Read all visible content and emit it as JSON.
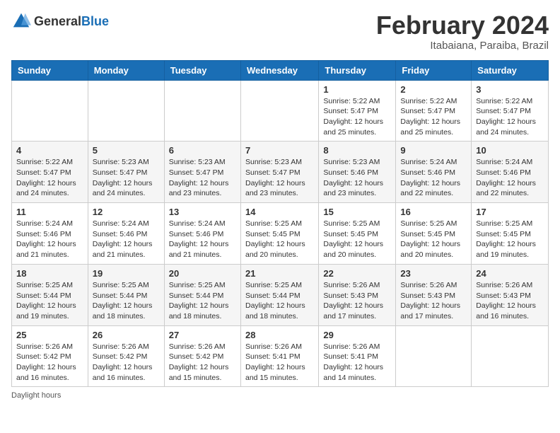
{
  "header": {
    "logo": {
      "general": "General",
      "blue": "Blue"
    },
    "title": "February 2024",
    "location": "Itabaiana, Paraiba, Brazil"
  },
  "calendar": {
    "days_of_week": [
      "Sunday",
      "Monday",
      "Tuesday",
      "Wednesday",
      "Thursday",
      "Friday",
      "Saturday"
    ],
    "weeks": [
      [
        {
          "day": "",
          "info": ""
        },
        {
          "day": "",
          "info": ""
        },
        {
          "day": "",
          "info": ""
        },
        {
          "day": "",
          "info": ""
        },
        {
          "day": "1",
          "info": "Sunrise: 5:22 AM\nSunset: 5:47 PM\nDaylight: 12 hours and 25 minutes."
        },
        {
          "day": "2",
          "info": "Sunrise: 5:22 AM\nSunset: 5:47 PM\nDaylight: 12 hours and 25 minutes."
        },
        {
          "day": "3",
          "info": "Sunrise: 5:22 AM\nSunset: 5:47 PM\nDaylight: 12 hours and 24 minutes."
        }
      ],
      [
        {
          "day": "4",
          "info": "Sunrise: 5:22 AM\nSunset: 5:47 PM\nDaylight: 12 hours and 24 minutes."
        },
        {
          "day": "5",
          "info": "Sunrise: 5:23 AM\nSunset: 5:47 PM\nDaylight: 12 hours and 24 minutes."
        },
        {
          "day": "6",
          "info": "Sunrise: 5:23 AM\nSunset: 5:47 PM\nDaylight: 12 hours and 23 minutes."
        },
        {
          "day": "7",
          "info": "Sunrise: 5:23 AM\nSunset: 5:47 PM\nDaylight: 12 hours and 23 minutes."
        },
        {
          "day": "8",
          "info": "Sunrise: 5:23 AM\nSunset: 5:46 PM\nDaylight: 12 hours and 23 minutes."
        },
        {
          "day": "9",
          "info": "Sunrise: 5:24 AM\nSunset: 5:46 PM\nDaylight: 12 hours and 22 minutes."
        },
        {
          "day": "10",
          "info": "Sunrise: 5:24 AM\nSunset: 5:46 PM\nDaylight: 12 hours and 22 minutes."
        }
      ],
      [
        {
          "day": "11",
          "info": "Sunrise: 5:24 AM\nSunset: 5:46 PM\nDaylight: 12 hours and 21 minutes."
        },
        {
          "day": "12",
          "info": "Sunrise: 5:24 AM\nSunset: 5:46 PM\nDaylight: 12 hours and 21 minutes."
        },
        {
          "day": "13",
          "info": "Sunrise: 5:24 AM\nSunset: 5:46 PM\nDaylight: 12 hours and 21 minutes."
        },
        {
          "day": "14",
          "info": "Sunrise: 5:25 AM\nSunset: 5:45 PM\nDaylight: 12 hours and 20 minutes."
        },
        {
          "day": "15",
          "info": "Sunrise: 5:25 AM\nSunset: 5:45 PM\nDaylight: 12 hours and 20 minutes."
        },
        {
          "day": "16",
          "info": "Sunrise: 5:25 AM\nSunset: 5:45 PM\nDaylight: 12 hours and 20 minutes."
        },
        {
          "day": "17",
          "info": "Sunrise: 5:25 AM\nSunset: 5:45 PM\nDaylight: 12 hours and 19 minutes."
        }
      ],
      [
        {
          "day": "18",
          "info": "Sunrise: 5:25 AM\nSunset: 5:44 PM\nDaylight: 12 hours and 19 minutes."
        },
        {
          "day": "19",
          "info": "Sunrise: 5:25 AM\nSunset: 5:44 PM\nDaylight: 12 hours and 18 minutes."
        },
        {
          "day": "20",
          "info": "Sunrise: 5:25 AM\nSunset: 5:44 PM\nDaylight: 12 hours and 18 minutes."
        },
        {
          "day": "21",
          "info": "Sunrise: 5:25 AM\nSunset: 5:44 PM\nDaylight: 12 hours and 18 minutes."
        },
        {
          "day": "22",
          "info": "Sunrise: 5:26 AM\nSunset: 5:43 PM\nDaylight: 12 hours and 17 minutes."
        },
        {
          "day": "23",
          "info": "Sunrise: 5:26 AM\nSunset: 5:43 PM\nDaylight: 12 hours and 17 minutes."
        },
        {
          "day": "24",
          "info": "Sunrise: 5:26 AM\nSunset: 5:43 PM\nDaylight: 12 hours and 16 minutes."
        }
      ],
      [
        {
          "day": "25",
          "info": "Sunrise: 5:26 AM\nSunset: 5:42 PM\nDaylight: 12 hours and 16 minutes."
        },
        {
          "day": "26",
          "info": "Sunrise: 5:26 AM\nSunset: 5:42 PM\nDaylight: 12 hours and 16 minutes."
        },
        {
          "day": "27",
          "info": "Sunrise: 5:26 AM\nSunset: 5:42 PM\nDaylight: 12 hours and 15 minutes."
        },
        {
          "day": "28",
          "info": "Sunrise: 5:26 AM\nSunset: 5:41 PM\nDaylight: 12 hours and 15 minutes."
        },
        {
          "day": "29",
          "info": "Sunrise: 5:26 AM\nSunset: 5:41 PM\nDaylight: 12 hours and 14 minutes."
        },
        {
          "day": "",
          "info": ""
        },
        {
          "day": "",
          "info": ""
        }
      ]
    ]
  },
  "footer": {
    "daylight_label": "Daylight hours"
  }
}
